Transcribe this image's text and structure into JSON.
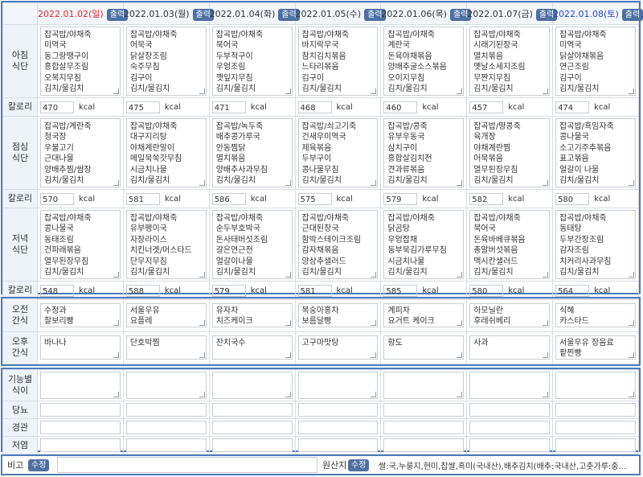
{
  "days": [
    {
      "date": "2022.01.02(일)",
      "kind": "sun"
    },
    {
      "date": "2022.01.03(월)",
      "kind": "normal"
    },
    {
      "date": "2022.01.04(화)",
      "kind": "normal"
    },
    {
      "date": "2022.01.05(수)",
      "kind": "normal"
    },
    {
      "date": "2022.01.06(목)",
      "kind": "normal"
    },
    {
      "date": "2022.01.07(금)",
      "kind": "normal"
    },
    {
      "date": "2022.01.08(토)",
      "kind": "sat"
    }
  ],
  "print_label": "출력",
  "edit_label": "수정",
  "kcal_unit": "kcal",
  "labels": {
    "breakfast": [
      "아침",
      "식단"
    ],
    "lunch": [
      "점심",
      "식단"
    ],
    "dinner": [
      "저녁",
      "식단"
    ],
    "calorie": "칼로리",
    "am_snack": [
      "오전",
      "간식"
    ],
    "pm_snack": [
      "오후",
      "간식"
    ],
    "functional": [
      "기능별",
      "식이"
    ],
    "diabetes": "당뇨",
    "tube": "경관",
    "lowsalt": "저염",
    "note": "비고",
    "origin": "원산지"
  },
  "breakfast": [
    [
      "잡곡밥/야채죽",
      "미역국",
      "동그랑땡구이",
      "흥합살무조림",
      "오복지무침",
      "김치/물김치"
    ],
    [
      "잡곡밥/야채죽",
      "어묵국",
      "닭살장조림",
      "숙주무침",
      "김구이",
      "김치/물김치"
    ],
    [
      "잡곡밥/야채죽",
      "북어국",
      "두부적구이",
      "우엉조림",
      "깻잎지무침",
      "김치/물김치"
    ],
    [
      "잡곡밥/야채죽",
      "바지락무국",
      "참치김치볶음",
      "느타리볶음",
      "김구이",
      "김치/물김치"
    ],
    [
      "잡곡밥/야채죽",
      "계란국",
      "돈육야채볶음",
      "양배추굴소스볶음",
      "오이지무침",
      "김치/물김치"
    ],
    [
      "잡곡밥/야채죽",
      "시래기된장국",
      "멸치볶음",
      "옛날소세지조림",
      "무짠지무침",
      "김치/물김치"
    ],
    [
      "잡곡밥/야채죽",
      "미역국",
      "닭살야채볶음",
      "연근조림",
      "김구이",
      "김치/물김치"
    ]
  ],
  "breakfast_kcal": [
    "470",
    "475",
    "471",
    "468",
    "460",
    "457",
    "474"
  ],
  "lunch": [
    [
      "잡곡밥/계란죽",
      "청국장",
      "우불고기",
      "근대나물",
      "양배추찜/쌈장",
      "김치/물김치"
    ],
    [
      "잡곡밥/야채죽",
      "대구지리탕",
      "야채계란말이",
      "메밀묵쑥갓무침",
      "시금치나물",
      "김치/물김치"
    ],
    [
      "잡곡밥/녹두죽",
      "배추콩가루국",
      "안동찜닭",
      "멸치볶음",
      "양배추사과무침",
      "김치/물김치"
    ],
    [
      "잡곡밥/쇠고기죽",
      "건새우미역국",
      "제육볶음",
      "두부구이",
      "콩나물무침",
      "김치/물김치"
    ],
    [
      "잡곡밥/콩죽",
      "유부우동국",
      "삼치구이",
      "흥합살김치전",
      "견과류볶음",
      "김치/물김치"
    ],
    [
      "잡곡밥/땅콩죽",
      "육개장",
      "야채계란찜",
      "어묵볶음",
      "열무된장무침",
      "김치/물김치"
    ],
    [
      "잡곡밥/흑임자죽",
      "콩나물국",
      "소고기주추볶음",
      "표고볶음",
      "얼갈이 나물",
      "김치/물김치"
    ]
  ],
  "lunch_kcal": [
    "570",
    "581",
    "586",
    "575",
    "579",
    "582",
    "580"
  ],
  "dinner": [
    [
      "잡곡밥/야채죽",
      "콩나물국",
      "동태조림",
      "건파래볶음",
      "열무된장무침",
      "김치/물김치"
    ],
    [
      "잡곡밥/야채죽",
      "유부팽이국",
      "자장라이스",
      "치킨너겟/머스타드",
      "단무지무침",
      "김치/물김치"
    ],
    [
      "잡곡밥/야채죽",
      "순두부호박국",
      "돈사태버섯조림",
      "갈은연근전",
      "얼갈이나물",
      "김치/물김치"
    ],
    [
      "잡곡밥/야채죽",
      "근대된장국",
      "함박스테이크조림",
      "감자채볶음",
      "양상추샐러드",
      "김치/물김치"
    ],
    [
      "잡곡밥/야채죽",
      "닭곰탕",
      "우엉잡채",
      "동부묵김가루무침",
      "시금치나물",
      "김치/물김치"
    ],
    [
      "잡곡밥/야채죽",
      "북어국",
      "돈육바베큐볶음",
      "총알버섯볶음",
      "맥시칸샐러드",
      "김치/물김치"
    ],
    [
      "잡곡밥/야채죽",
      "동태탕",
      "두부간장조림",
      "감자조림",
      "치커리사과무침",
      "김치/물김치"
    ]
  ],
  "dinner_kcal": [
    "548",
    "588",
    "579",
    "581",
    "585",
    "580",
    "564"
  ],
  "am_snack": [
    [
      "수정과",
      "찰보리빵"
    ],
    [
      "서울우유",
      "요플레"
    ],
    [
      "유자차",
      "치즈케이크"
    ],
    [
      "복숭아홍차",
      "보름달빵"
    ],
    [
      "계피차",
      "요거트 케이크"
    ],
    [
      "하모닐란",
      "후레쉬베리"
    ],
    [
      "식혜",
      "카스타드"
    ]
  ],
  "pm_snack": [
    [
      "바나나"
    ],
    [
      "단호박찜"
    ],
    [
      "잔치국수"
    ],
    [
      "고구마맛탕"
    ],
    [
      "황도"
    ],
    [
      "사과"
    ],
    [
      "서울우유 장음료",
      "팥찐빵"
    ]
  ],
  "origin_text": "쌀:국,누룽지,현미,찹쌀,흑미(국내산),배추김치(배추:국내산,고춧가루:중..."
}
